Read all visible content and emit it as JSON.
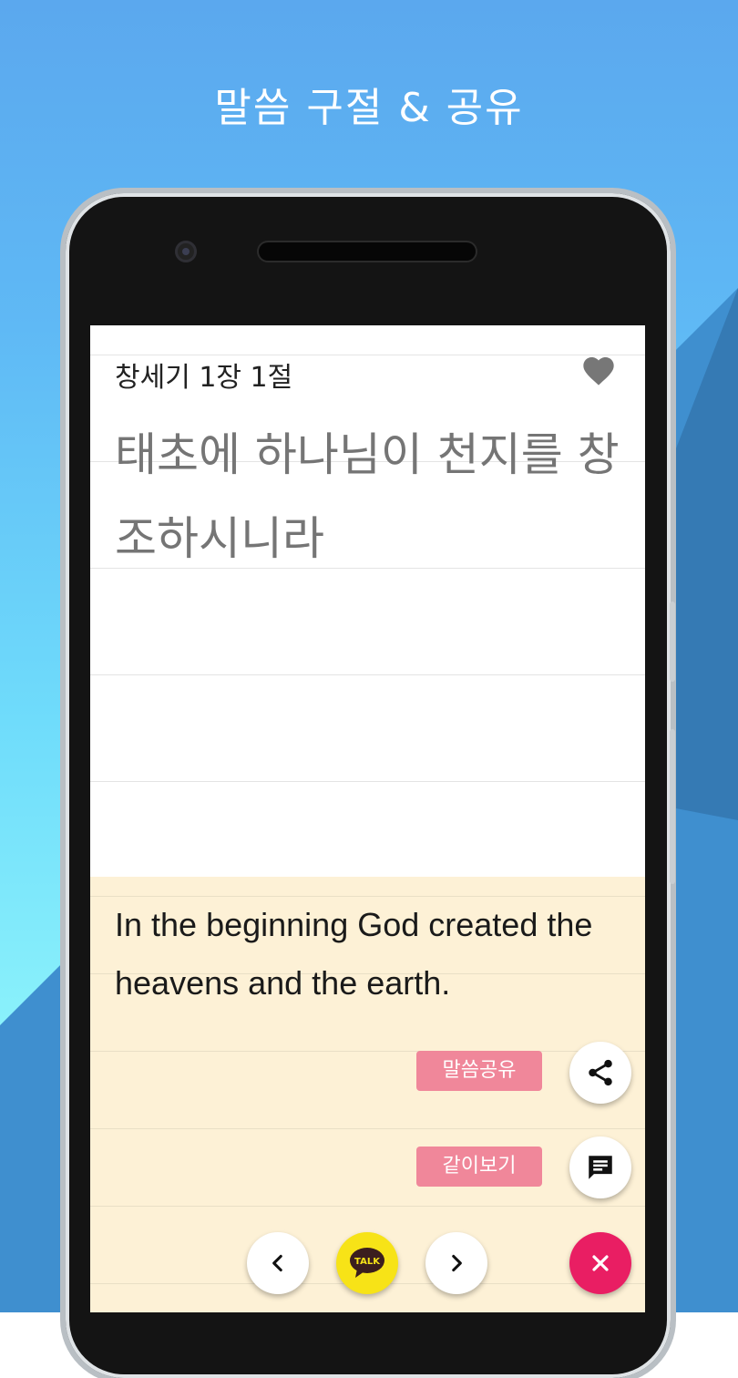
{
  "headline": "말씀 구절 & 공유",
  "verse": {
    "reference": "창세기 1장 1절",
    "korean": "태초에 하나님이 천지를 창조하시니라",
    "english": "In the beginning God created the heavens and the earth."
  },
  "actions": {
    "share_label": "말씀공유",
    "compare_label": "같이보기",
    "kakao_label": "TALK"
  },
  "icons": {
    "favorite": "heart-icon",
    "share": "share-icon",
    "compare": "message-icon",
    "prev": "chevron-left-icon",
    "next": "chevron-right-icon",
    "close": "close-icon"
  },
  "colors": {
    "background_top": "#5ba8ee",
    "background_bottom": "#8cf3fb",
    "english_panel": "#fdf1d6",
    "pill": "#f0879a",
    "kakao": "#f7e317",
    "close_fab": "#e91e63"
  }
}
